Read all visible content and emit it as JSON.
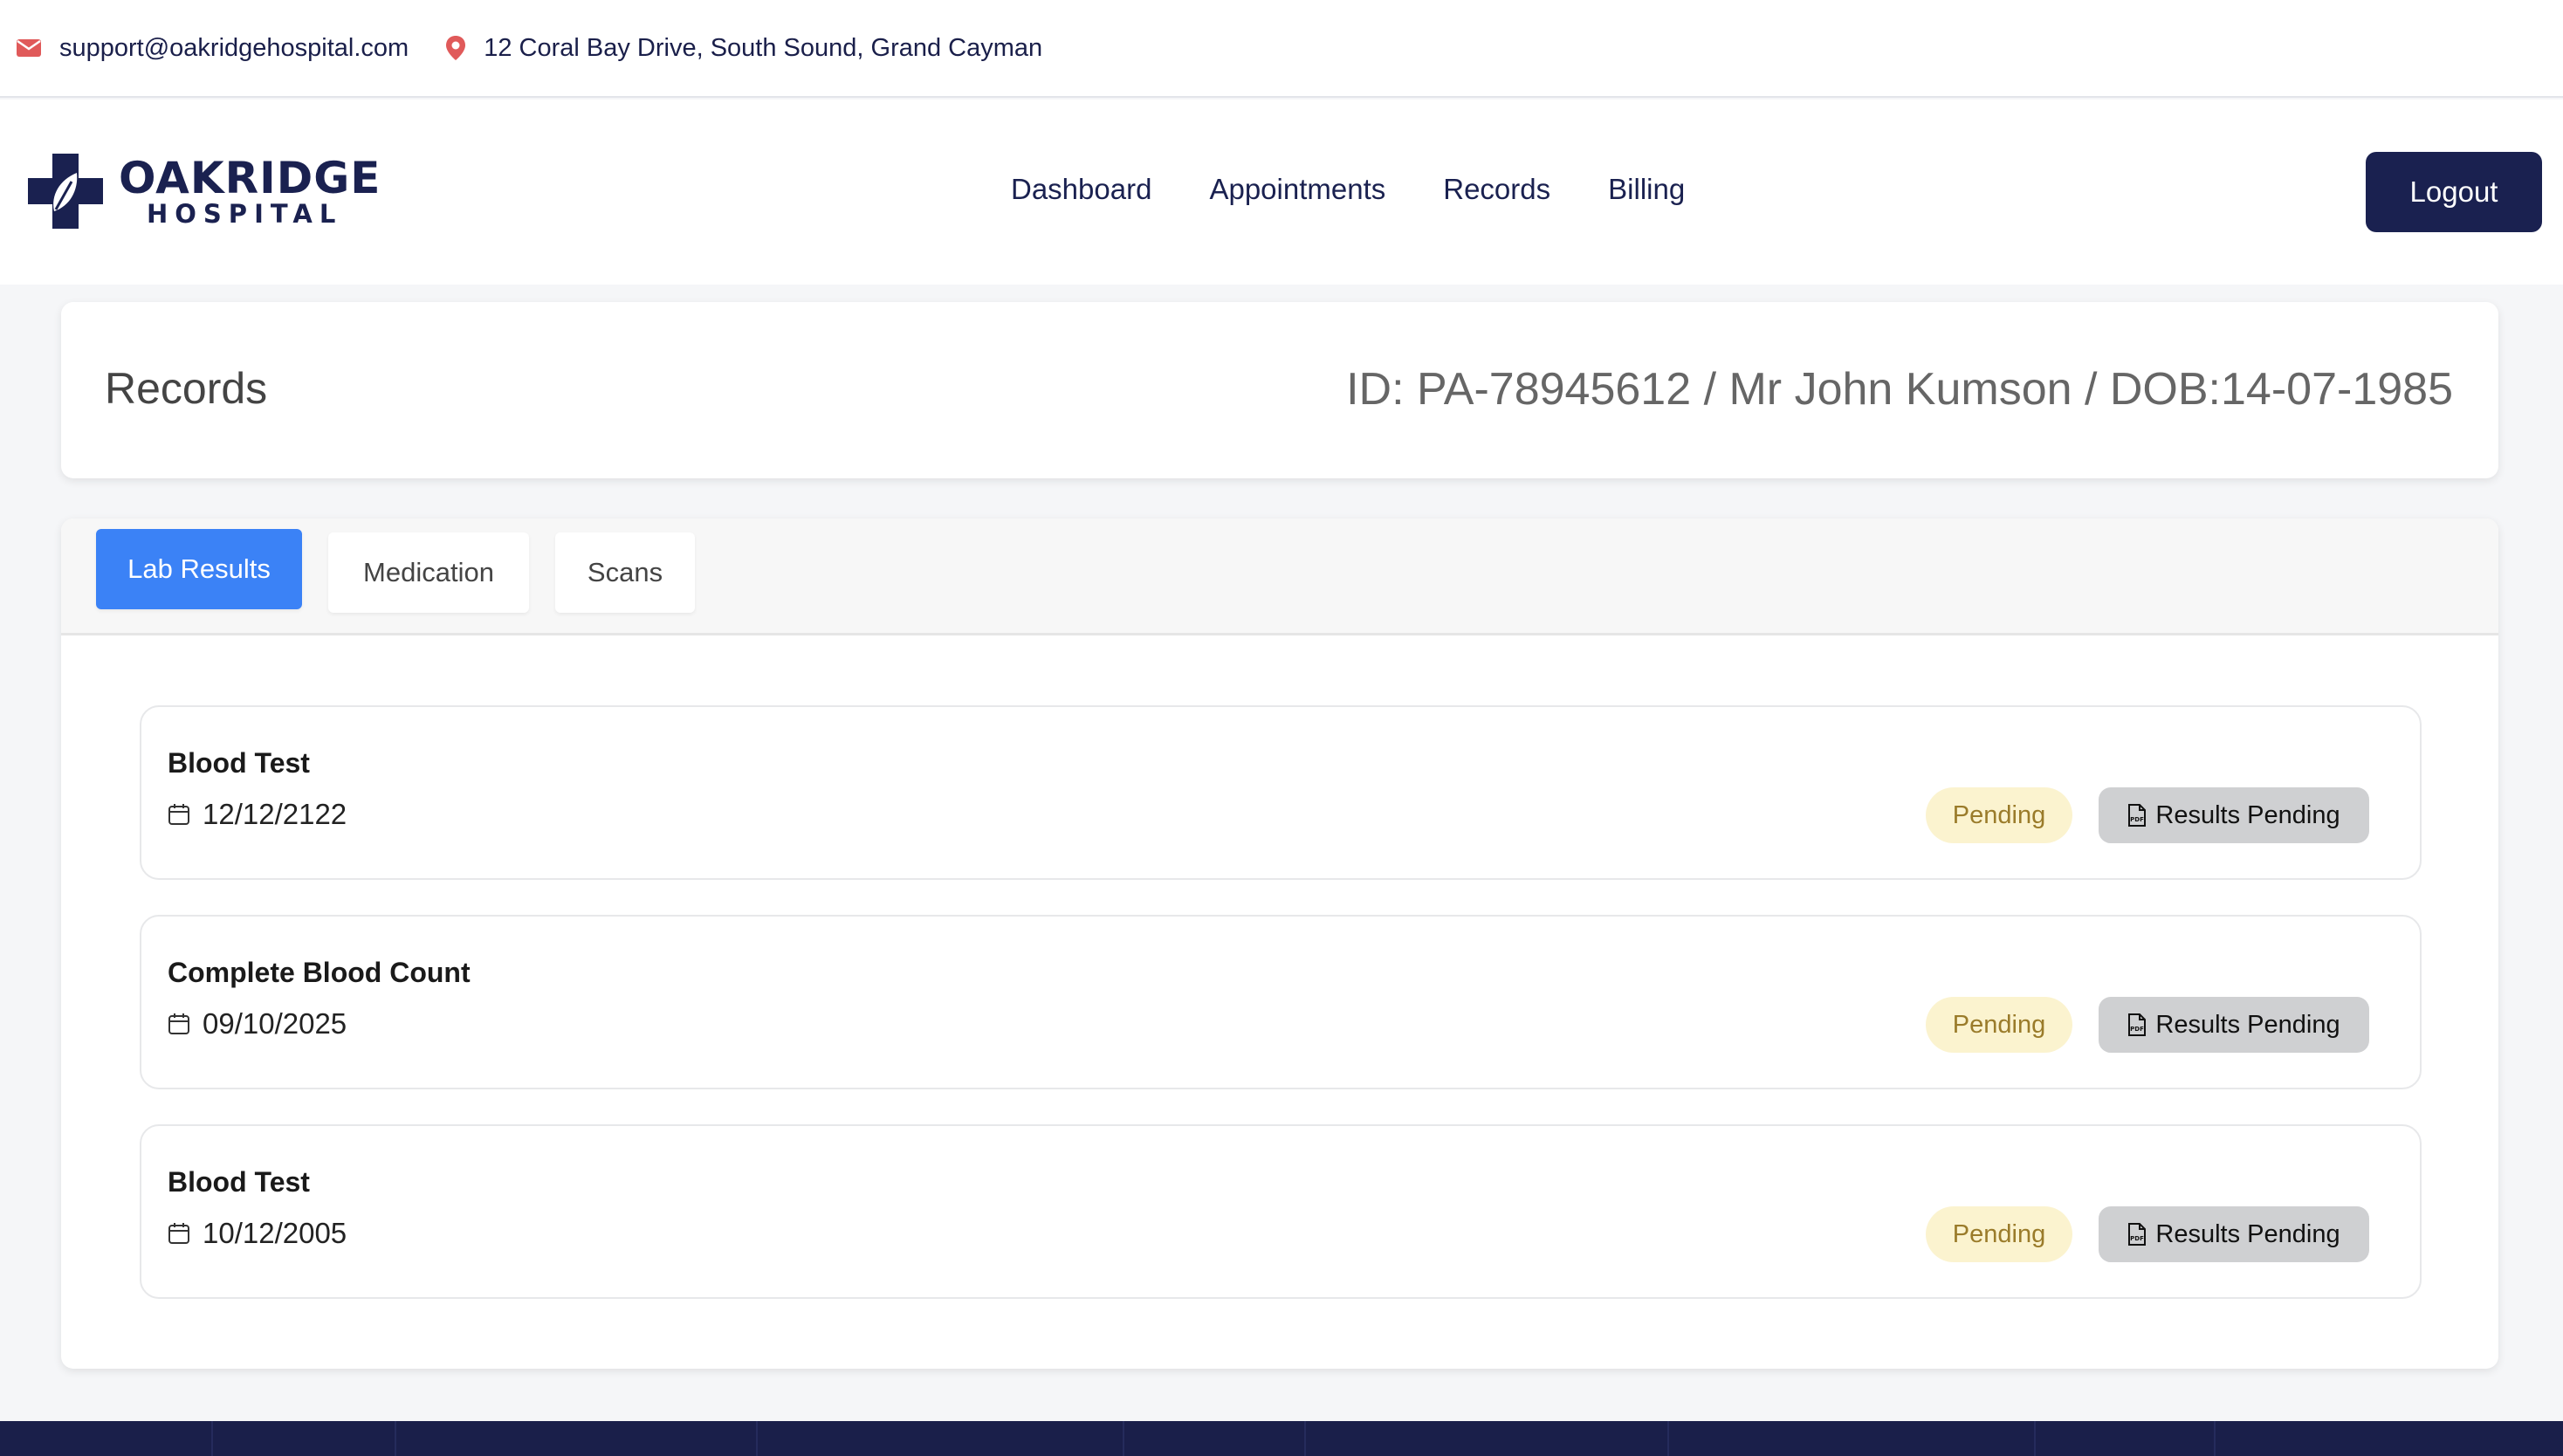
{
  "topbar": {
    "email": "support@oakridgehospital.com",
    "address": "12 Coral Bay Drive, South Sound, Grand Cayman",
    "email_icon": "envelope-icon",
    "address_icon": "map-pin-icon"
  },
  "brand": {
    "name": "OAKRIDGE",
    "sub": "HOSPITAL",
    "icon": "cross-leaf-icon"
  },
  "nav": {
    "links": [
      "Dashboard",
      "Appointments",
      "Records",
      "Billing"
    ],
    "logout_label": "Logout"
  },
  "page": {
    "title": "Records",
    "patient_info": "ID: PA-78945612 / Mr John Kumson / DOB:14-07-1985"
  },
  "tabs": [
    {
      "label": "Lab Results",
      "active": true
    },
    {
      "label": "Medication",
      "active": false
    },
    {
      "label": "Scans",
      "active": false
    }
  ],
  "records": [
    {
      "title": "Blood Test",
      "date": "12/12/2122",
      "status": "Pending",
      "action": "Results Pending",
      "date_icon": "calendar-icon",
      "action_icon": "pdf-file-icon"
    },
    {
      "title": "Complete Blood Count",
      "date": "09/10/2025",
      "status": "Pending",
      "action": "Results Pending",
      "date_icon": "calendar-icon",
      "action_icon": "pdf-file-icon"
    },
    {
      "title": "Blood Test",
      "date": "10/12/2005",
      "status": "Pending",
      "action": "Results Pending",
      "date_icon": "calendar-icon",
      "action_icon": "pdf-file-icon"
    }
  ],
  "colors": {
    "brand_navy": "#1a2150",
    "active_tab": "#3b82f6",
    "pending_bg": "#fbf3cf",
    "pending_text": "#9a7b2a",
    "icon_red": "#e05a5a"
  }
}
